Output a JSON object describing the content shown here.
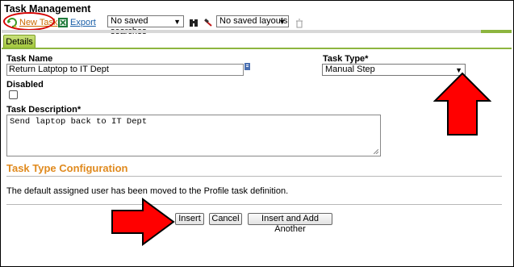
{
  "page": {
    "title": "Task Management"
  },
  "toolbar": {
    "new_task_label": "New Task",
    "export_label": "Export",
    "saved_searches": "No saved searches",
    "saved_layouts": "No saved layouts"
  },
  "tabs": [
    {
      "label": "Details"
    }
  ],
  "form": {
    "task_name": {
      "label": "Task Name",
      "value": "Return Latptop to IT Dept"
    },
    "disabled": {
      "label": "Disabled",
      "checked": false
    },
    "task_description": {
      "label": "Task Description*",
      "value": "Send laptop back to IT Dept"
    },
    "task_type": {
      "label": "Task Type*",
      "value": "Manual Step"
    }
  },
  "config": {
    "heading": "Task Type Configuration",
    "message": "The default assigned user has been moved to the Profile task definition."
  },
  "buttons": {
    "insert": "Insert",
    "cancel": "Cancel",
    "insert_add_another": "Insert and Add Another"
  },
  "annotations": {
    "color": "#ff0000",
    "outline_color": "#000000",
    "oval_color": "#d40000"
  },
  "colors": {
    "accent_green": "#8db53f",
    "heading_orange": "#e08a1e",
    "new_task_link": "#cc6a00",
    "export_link": "#1a5fa8"
  }
}
